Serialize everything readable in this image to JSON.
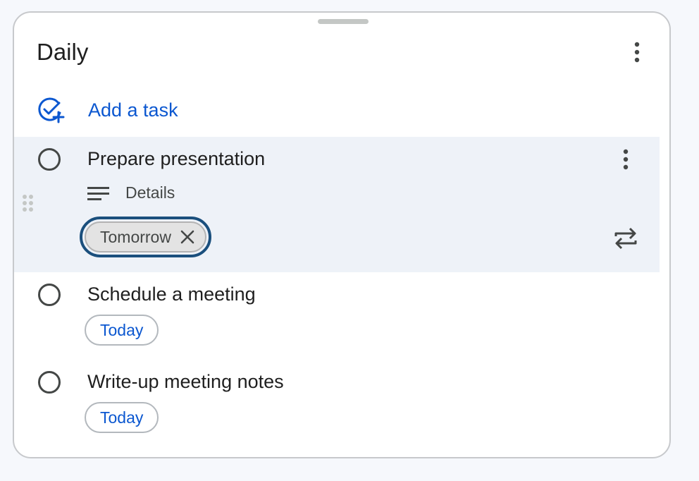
{
  "list": {
    "title": "Daily"
  },
  "add_task": {
    "label": "Add a task"
  },
  "tasks": [
    {
      "title": "Prepare presentation",
      "details_label": "Details",
      "date_chip": "Tomorrow",
      "selected": true
    },
    {
      "title": "Schedule a meeting",
      "date_chip": "Today"
    },
    {
      "title": "Write-up meeting notes",
      "date_chip": "Today"
    }
  ],
  "icons": {
    "add_task": "add-task-icon",
    "more": "more-vert-icon",
    "details": "notes-icon",
    "repeat": "repeat-icon",
    "close": "close-icon",
    "drag": "drag-indicator-icon"
  },
  "colors": {
    "accent": "#0b57d0",
    "selected_row": "#eef2f8",
    "focus_ring": "#1a4f7d"
  }
}
